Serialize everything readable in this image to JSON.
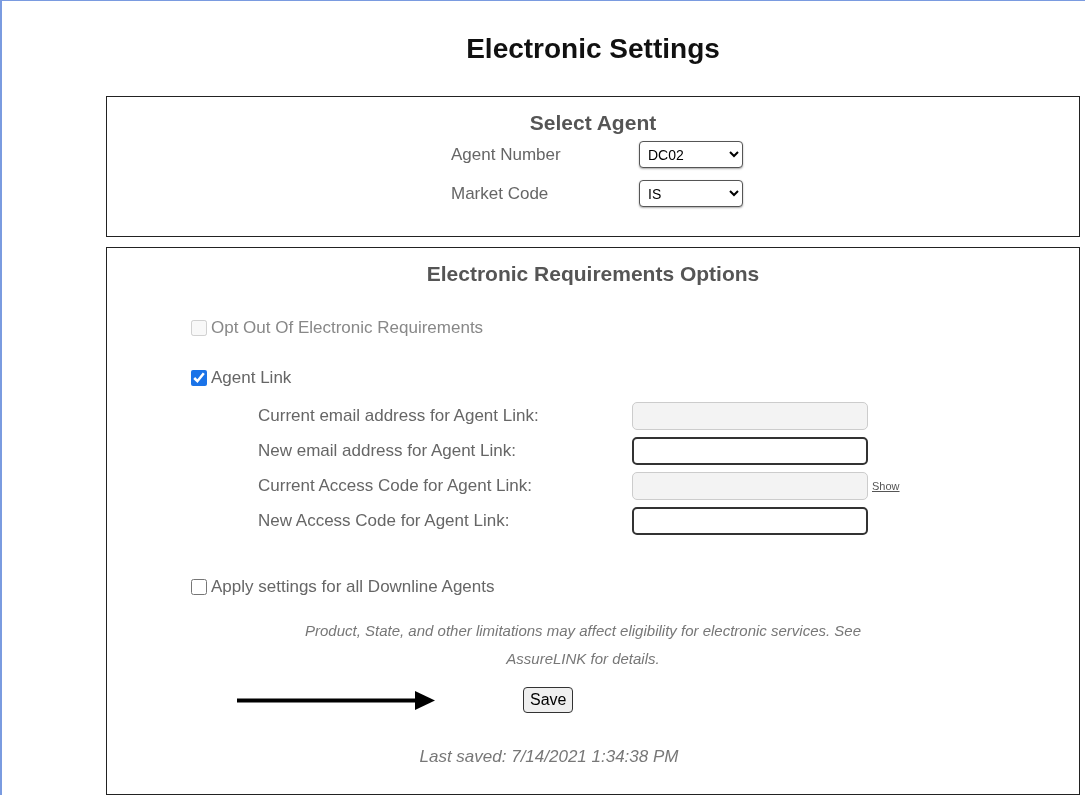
{
  "title": "Electronic Settings",
  "select_agent": {
    "heading": "Select Agent",
    "fields": [
      {
        "label": "Agent Number",
        "value": "DC02"
      },
      {
        "label": "Market Code",
        "value": "IS"
      }
    ]
  },
  "options": {
    "heading": "Electronic Requirements Options",
    "opt_out": {
      "label": "Opt Out Of Electronic Requirements",
      "checked": false,
      "disabled": true
    },
    "agent_link": {
      "label": "Agent Link",
      "checked": true,
      "disabled": false,
      "fields": [
        {
          "label": "Current email address for Agent Link:",
          "disabled": true
        },
        {
          "label": "New email address for Agent Link:",
          "disabled": false
        },
        {
          "label": "Current Access Code for Agent Link:",
          "disabled": true,
          "link": "Show"
        },
        {
          "label": "New Access Code for Agent Link:",
          "disabled": false
        }
      ]
    },
    "downline": {
      "label": "Apply settings for all Downline Agents",
      "checked": false,
      "disabled": false
    },
    "note": "Product, State, and other limitations may affect eligibility for electronic services. See AssureLINK for details.",
    "save": "Save",
    "last_saved": "Last saved: 7/14/2021 1:34:38 PM"
  }
}
